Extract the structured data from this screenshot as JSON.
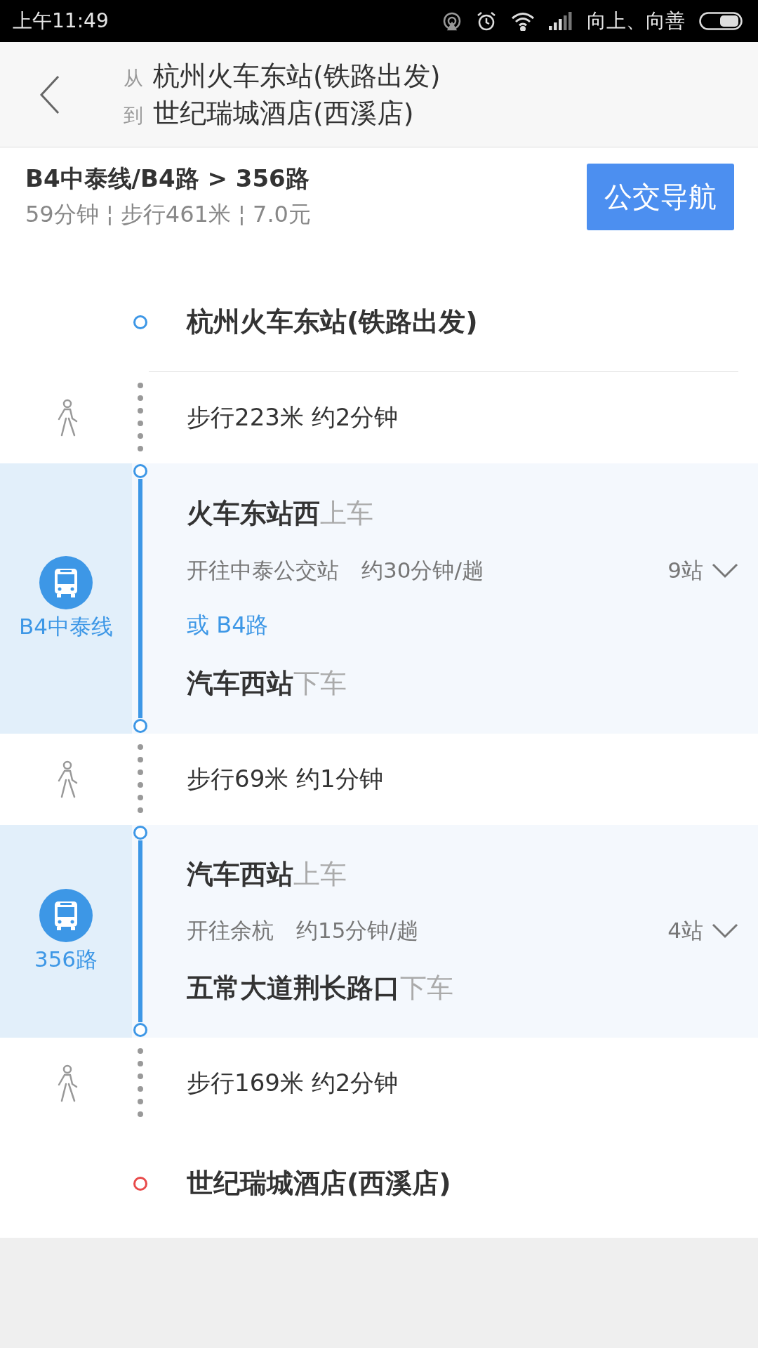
{
  "status_bar": {
    "time": "上午11:49",
    "carrier": "向上、向善"
  },
  "header": {
    "from_label": "从",
    "from": "杭州火车东站(铁路出发)",
    "to_label": "到",
    "to": "世纪瑞城酒店(西溪店)"
  },
  "summary": {
    "title": "B4中泰线/B4路 > 356路",
    "details": "59分钟 ¦ 步行461米 ¦ 7.0元",
    "nav_button": "公交导航"
  },
  "steps": [
    {
      "kind": "start",
      "name": "杭州火车东站(铁路出发)"
    },
    {
      "kind": "walk",
      "text": "步行223米 约2分钟"
    },
    {
      "kind": "bus",
      "line": "B4中泰线",
      "board": "**火车东站西**上车",
      "direction": "开往中泰公交站",
      "frequency": "约30分钟/趟",
      "stops": "9站",
      "expanded": false,
      "alternative": "或 B4路",
      "alight": "**汽车西站**下车"
    },
    {
      "kind": "walk",
      "text": "步行69米 约1分钟"
    },
    {
      "kind": "bus",
      "line": "356路",
      "board": "**汽车西站**上车",
      "direction": "开往余杭",
      "frequency": "约15分钟/趟",
      "stops": "4站",
      "expanded": false,
      "alight": "**五常大道荆长路口**下车"
    },
    {
      "kind": "walk",
      "text": "步行169米 约2分钟"
    },
    {
      "kind": "end",
      "name": "世纪瑞城酒店(西溪店)"
    }
  ]
}
